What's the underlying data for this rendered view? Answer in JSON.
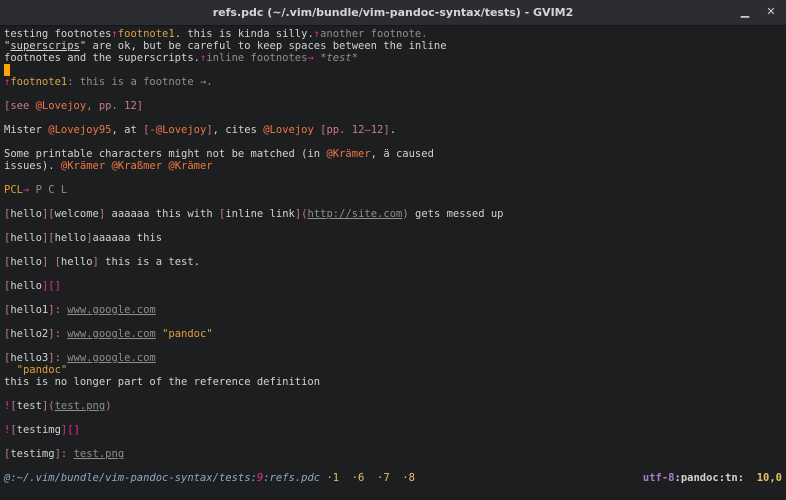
{
  "window": {
    "title": "refs.pdc (~/.vim/bundle/vim-pandoc-syntax/tests) - GVIM2",
    "min_glyph": "▁",
    "max_glyph": "□",
    "close_glyph": "✕"
  },
  "lines": {
    "l1": {
      "a": "testing footnotes",
      "b": "↑",
      "c": "footnote1",
      "d": ". this is kinda silly.",
      "e": "↑",
      "f": "another footnote."
    },
    "l2": {
      "a": "\"",
      "b": "superscrips",
      "c": "\" are ok, but be careful to keep spaces between the inline"
    },
    "l3": {
      "a": "footnotes and the superscripts.",
      "b": "↑",
      "c": "inline footnotes",
      "d": "→ ",
      "e": "*test*"
    },
    "l5": {
      "a": "↑",
      "b": "footnote1",
      "c": ": this is a footnote →."
    },
    "l7": {
      "a": "[see ",
      "b": "@Lovejoy",
      "c": ", pp. 12",
      "d": "]"
    },
    "l9": {
      "a": "Mister ",
      "b": "@Lovejoy95",
      "c": ", at ",
      "d": "[",
      "e": "-@Lovejoy",
      "f": "]",
      "g": ", cites ",
      "h": "@Lovejoy",
      "i": " ",
      "j": "[pp. 12–12]",
      "k": "."
    },
    "l11": {
      "a": "Some printable characters might not be matched (in ",
      "b": "@Krämer",
      "c": ", ä caused"
    },
    "l12": {
      "a": "issues). ",
      "b": "@Krämer @Kraßmer @Krämer"
    },
    "l14": {
      "a": "PCL",
      "b": "→",
      "c": " P C L"
    },
    "l16": {
      "a": "[",
      "b": "hello",
      "c": "][",
      "d": "welcome",
      "e": "]",
      "f": " aaaaaa this with ",
      "g": "[",
      "h": "inline link",
      "i": "](",
      "j": "http://site.com",
      "k": ")",
      "l": " gets messed up"
    },
    "l18": {
      "a": "[",
      "b": "hello",
      "c": "][",
      "d": "hello",
      "e": "]",
      "f": "aaaaaa this"
    },
    "l20": {
      "a": "[",
      "b": "hello",
      "c": "]",
      "d": " ",
      "e": "[",
      "f": "hello",
      "g": "]",
      "h": " this is a test."
    },
    "l22": {
      "a": "[",
      "b": "hello",
      "c": "][]"
    },
    "l24": {
      "a": "[",
      "b": "hello1",
      "c": "]: ",
      "d": "www.google.com"
    },
    "l26": {
      "a": "[",
      "b": "hello2",
      "c": "]: ",
      "d": "www.google.com",
      "e": " ",
      "f": "\"pandoc\""
    },
    "l28": {
      "a": "[",
      "b": "hello3",
      "c": "]: ",
      "d": "www.google.com"
    },
    "l29": {
      "a": "  \"pandoc\""
    },
    "l30": {
      "a": "this is no longer part of the reference definition"
    },
    "l32": {
      "a": "!",
      "b": "[",
      "c": "test",
      "d": "](",
      "e": "test.png",
      "f": ")"
    },
    "l34": {
      "a": "!",
      "b": "[",
      "c": "testimg",
      "d": "][]"
    },
    "l36": {
      "a": "[",
      "b": "testimg",
      "c": "]: ",
      "d": "test.png"
    }
  },
  "status": {
    "left_a": "@:",
    "left_b": "~/.vim/bundle/vim-pandoc-syntax/tests",
    "left_c": ":",
    "left_d": "9",
    "left_e": ":",
    "left_f": "refs.pdc",
    "left_g": " ·1  ·6  ·7  ·8",
    "right_a": "utf-8",
    "right_b": ":",
    "right_c": "pandoc",
    "right_d": ":",
    "right_e": "tn",
    "right_f": ":  ",
    "right_g": "10,0"
  },
  "colors": {
    "background": "#1c1e20",
    "text": "#d2d2d2",
    "marker": "#e0308a",
    "citation": "#ee7744",
    "string": "#e0a035",
    "cursor": "#ffa500"
  }
}
